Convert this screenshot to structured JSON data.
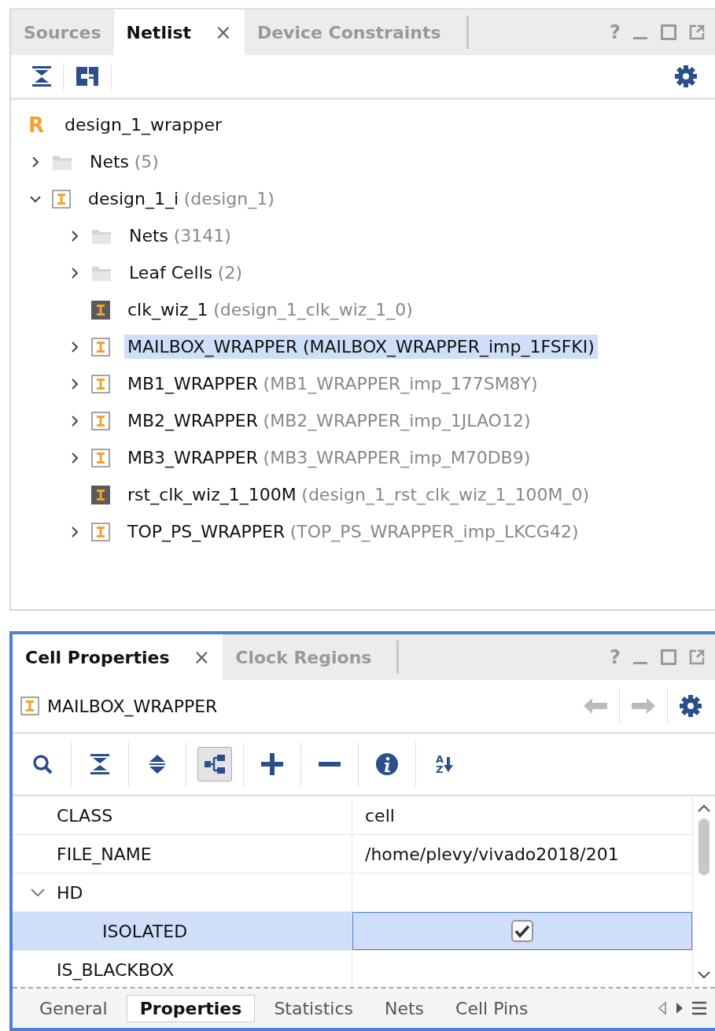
{
  "netlist_panel": {
    "tabs": [
      {
        "label": "Sources",
        "selected": false
      },
      {
        "label": "Netlist",
        "selected": true,
        "close": "×"
      },
      {
        "label": "Device Constraints",
        "selected": false
      }
    ],
    "help": "?",
    "tree": [
      {
        "kind": "root",
        "badge": "R",
        "name": "design_1_wrapper",
        "selected": false,
        "children": [
          {
            "kind": "folder",
            "name": "Nets",
            "detail": "(5)",
            "selected": false,
            "expanded": false
          },
          {
            "kind": "cell",
            "name": "design_1_i",
            "detail": "(design_1)",
            "selected": false,
            "expanded": true,
            "children": [
              {
                "kind": "folder",
                "name": "Nets",
                "detail": "(3141)",
                "selected": false,
                "expanded": false
              },
              {
                "kind": "folder",
                "name": "Leaf Cells",
                "detail": "(2)",
                "selected": false,
                "expanded": false
              },
              {
                "kind": "leaf",
                "name": "clk_wiz_1",
                "detail": "(design_1_clk_wiz_1_0)",
                "selected": false
              },
              {
                "kind": "cell",
                "name": "MAILBOX_WRAPPER",
                "detail": "(MAILBOX_WRAPPER_imp_1FSFKI)",
                "selected": true,
                "expanded": false
              },
              {
                "kind": "cell",
                "name": "MB1_WRAPPER",
                "detail": "(MB1_WRAPPER_imp_177SM8Y)",
                "selected": false,
                "expanded": false
              },
              {
                "kind": "cell",
                "name": "MB2_WRAPPER",
                "detail": "(MB2_WRAPPER_imp_1JLAO12)",
                "selected": false,
                "expanded": false
              },
              {
                "kind": "cell",
                "name": "MB3_WRAPPER",
                "detail": "(MB3_WRAPPER_imp_M70DB9)",
                "selected": false,
                "expanded": false
              },
              {
                "kind": "leaf",
                "name": "rst_clk_wiz_1_100M",
                "detail": "(design_1_rst_clk_wiz_1_100M_0)",
                "selected": false
              },
              {
                "kind": "cell",
                "name": "TOP_PS_WRAPPER",
                "detail": "(TOP_PS_WRAPPER_imp_LKCG42)",
                "selected": false,
                "expanded": false
              }
            ]
          }
        ]
      }
    ]
  },
  "properties_panel": {
    "tabs": [
      {
        "label": "Cell Properties",
        "selected": true,
        "close": "×"
      },
      {
        "label": "Clock Regions",
        "selected": false
      }
    ],
    "help": "?",
    "object": "MAILBOX_WRAPPER",
    "toolbar": [
      {
        "kind": "search",
        "on": false
      },
      {
        "kind": "collapse",
        "on": false
      },
      {
        "kind": "expand",
        "on": false
      },
      {
        "kind": "hierarchy",
        "on": true
      },
      {
        "kind": "add",
        "on": false
      },
      {
        "kind": "remove",
        "on": false
      },
      {
        "kind": "info",
        "on": false
      },
      {
        "kind": "sort",
        "on": false,
        "top": "A",
        "bottom": "Z"
      }
    ],
    "rows": [
      {
        "kind": "text",
        "name": "CLASS",
        "value": "cell",
        "selected": false
      },
      {
        "kind": "text",
        "name": "FILE_NAME",
        "value": "/home/plevy/vivado2018/201",
        "selected": false
      },
      {
        "kind": "group",
        "name": "HD",
        "selected": false,
        "expanded": true,
        "children": [
          {
            "kind": "checkbox",
            "name": "ISOLATED",
            "checked": true,
            "selected": true
          }
        ]
      },
      {
        "kind": "text",
        "name": "IS_BLACKBOX",
        "selected": false
      }
    ],
    "bottom_tabs": [
      {
        "label": "General",
        "selected": false
      },
      {
        "label": "Properties",
        "selected": true
      },
      {
        "label": "Statistics",
        "selected": false
      },
      {
        "label": "Nets",
        "selected": false
      },
      {
        "label": "Cell Pins",
        "selected": false
      }
    ]
  }
}
